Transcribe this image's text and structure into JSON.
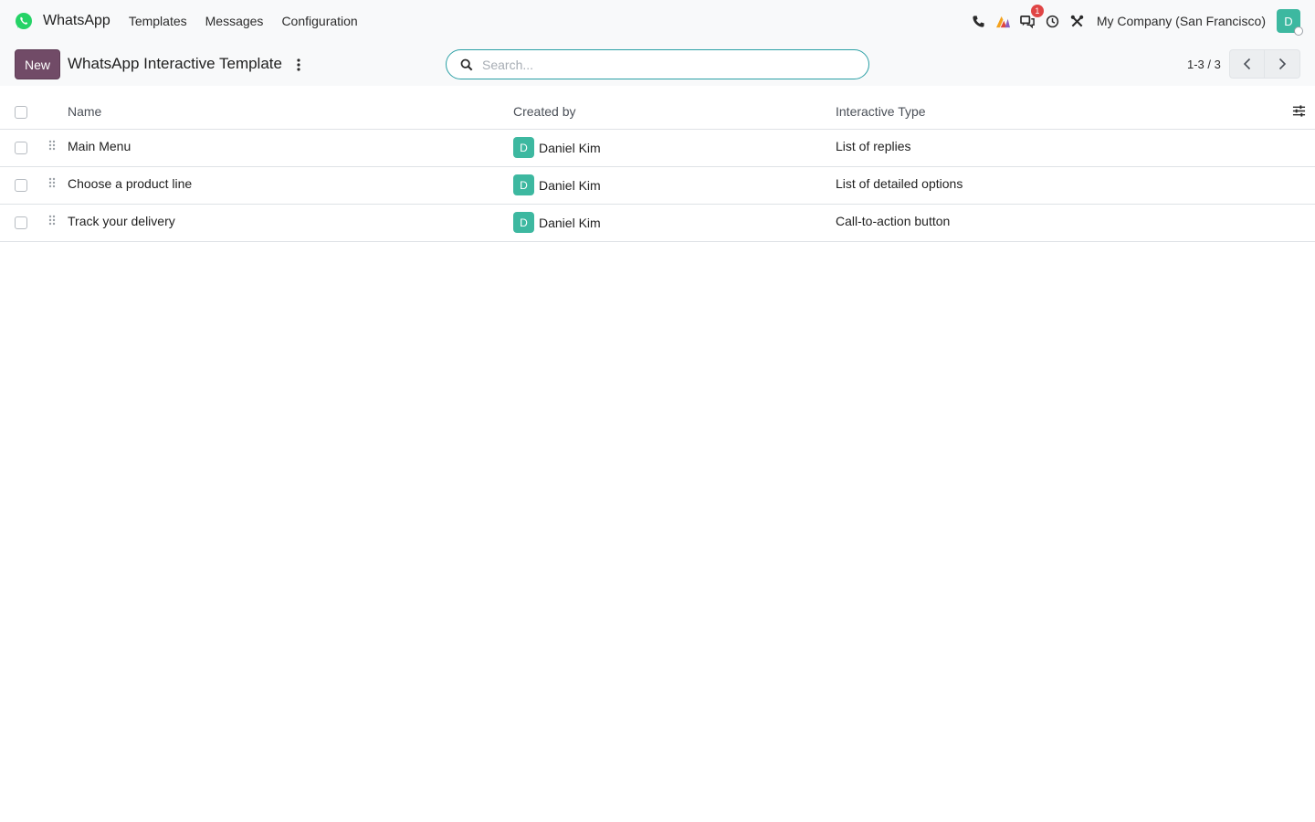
{
  "navbar": {
    "brand": "WhatsApp",
    "menu": [
      "Templates",
      "Messages",
      "Configuration"
    ],
    "company": "My Company (San Francisco)",
    "user_initial": "D",
    "messages_badge": "1"
  },
  "control": {
    "new_label": "New",
    "title": "WhatsApp Interactive Template",
    "search_placeholder": "Search...",
    "pager": "1-3 / 3"
  },
  "table": {
    "columns": [
      "Name",
      "Created by",
      "Interactive Type"
    ],
    "rows": [
      {
        "name": "Main Menu",
        "creator_initial": "D",
        "creator": "Daniel Kim",
        "type": "List of replies"
      },
      {
        "name": "Choose a product line",
        "creator_initial": "D",
        "creator": "Daniel Kim",
        "type": "List of detailed options"
      },
      {
        "name": "Track your delivery",
        "creator_initial": "D",
        "creator": "Daniel Kim",
        "type": "Call-to-action button"
      }
    ]
  },
  "colors": {
    "primary": "#714b67",
    "whatsapp_green": "#25d366",
    "avatar": "#3db8a0",
    "search_border": "#2ba0a5",
    "badge": "#e04545"
  },
  "icons": [
    "whatsapp-logo",
    "phone-icon",
    "activity-icon",
    "messages-icon",
    "clock-icon",
    "tools-icon",
    "kebab-icon",
    "search-icon",
    "chevron-left-icon",
    "chevron-right-icon",
    "drag-handle-icon",
    "column-settings-icon"
  ]
}
